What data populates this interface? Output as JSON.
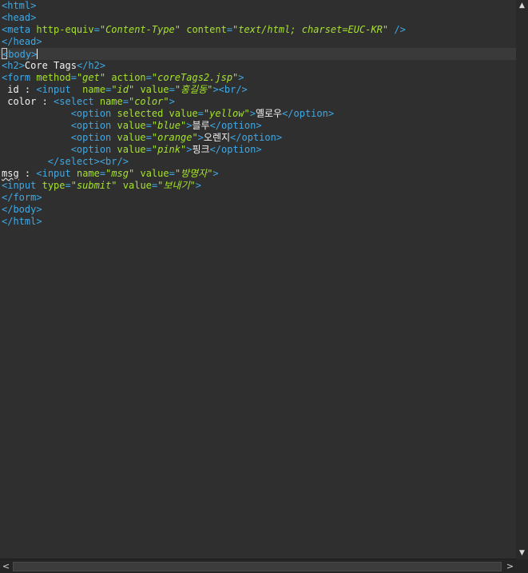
{
  "editor": {
    "lines": [
      "<html>",
      "<head>",
      "<meta http-equiv=\"Content-Type\" content=\"text/html; charset=EUC-KR\" />",
      "</head>",
      "<body>",
      "<h2>Core Tags</h2>",
      "<form method=\"get\" action=\"coreTags2.jsp\">",
      " id : <input  name=\"id\" value=\"홍길동\"><br/>",
      " color : <select name=\"color\">",
      "            <option selected value=\"yellow\">옐로우</option>",
      "            <option value=\"blue\">블루</option>",
      "            <option value=\"orange\">오렌지</option>",
      "            <option value=\"pink\">핑크</option>",
      "        </select><br/>",
      "msg : <input name=\"msg\" value=\"방명자\">",
      "<input type=\"submit\" value=\"보내기\">",
      "</form>",
      "</body>",
      "</html>"
    ],
    "current_line": 4
  },
  "scrollbar": {
    "up_icon": "▲",
    "down_icon": "▼",
    "left_icon": "<",
    "right_icon": ">"
  }
}
